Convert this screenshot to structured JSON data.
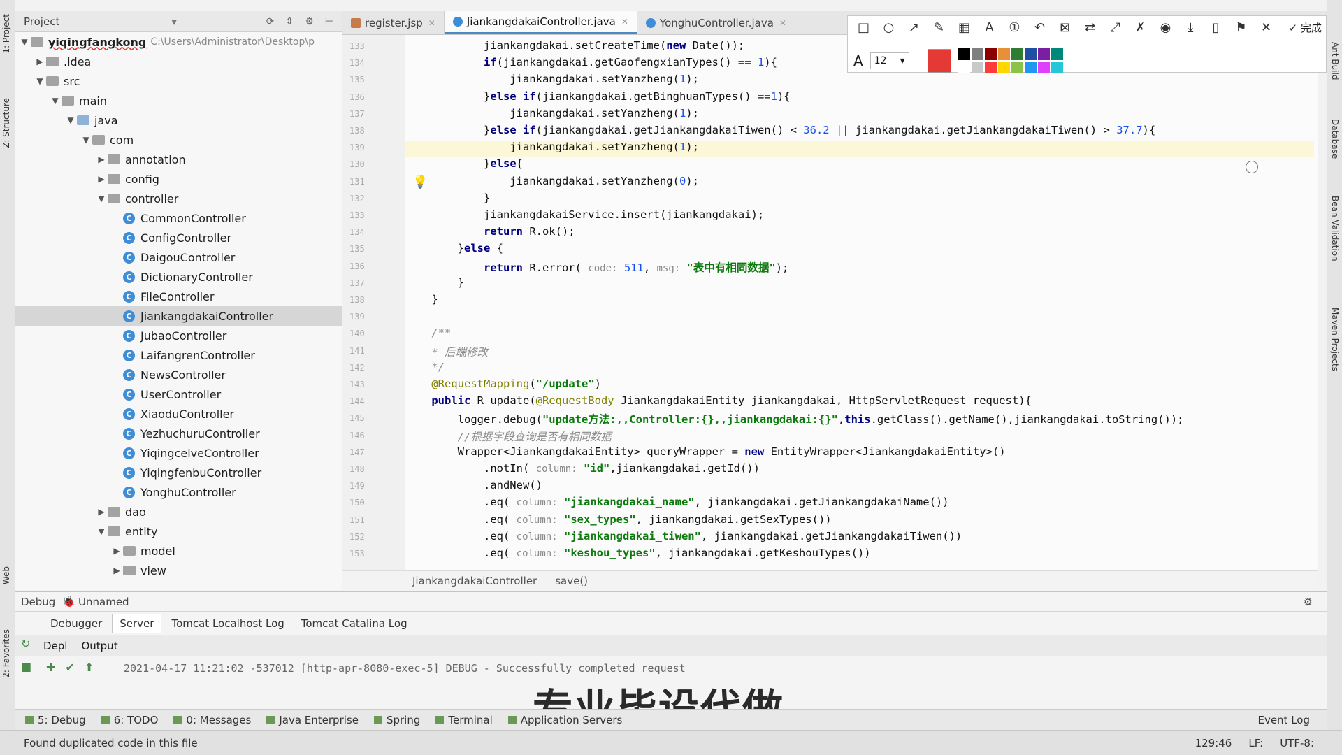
{
  "left_strip": {
    "tab1": "1: Project",
    "tab2": "Z: Structure",
    "tab3": "Web",
    "tab4": "2: Favorites"
  },
  "right_strip": {
    "tab1": "Ant Build",
    "tab2": "Database",
    "tab3": "Bean Validation",
    "tab4": "Maven Projects"
  },
  "project": {
    "header": "Project",
    "root": "yiqingfangkong",
    "root_path": "C:\\Users\\Administrator\\Desktop\\p",
    "tree": [
      {
        "label": ".idea",
        "level": 1,
        "arrow": "▶",
        "kind": "folder"
      },
      {
        "label": "src",
        "level": 1,
        "arrow": "▼",
        "kind": "folder"
      },
      {
        "label": "main",
        "level": 2,
        "arrow": "▼",
        "kind": "folder"
      },
      {
        "label": "java",
        "level": 3,
        "arrow": "▼",
        "kind": "folder-blue"
      },
      {
        "label": "com",
        "level": 4,
        "arrow": "▼",
        "kind": "folder"
      },
      {
        "label": "annotation",
        "level": 5,
        "arrow": "▶",
        "kind": "folder"
      },
      {
        "label": "config",
        "level": 5,
        "arrow": "▶",
        "kind": "folder"
      },
      {
        "label": "controller",
        "level": 5,
        "arrow": "▼",
        "kind": "folder"
      },
      {
        "label": "CommonController",
        "level": 6,
        "kind": "class"
      },
      {
        "label": "ConfigController",
        "level": 6,
        "kind": "class"
      },
      {
        "label": "DaigouController",
        "level": 6,
        "kind": "class"
      },
      {
        "label": "DictionaryController",
        "level": 6,
        "kind": "class"
      },
      {
        "label": "FileController",
        "level": 6,
        "kind": "class"
      },
      {
        "label": "JiankangdakaiController",
        "level": 6,
        "kind": "class",
        "selected": true
      },
      {
        "label": "JubaoController",
        "level": 6,
        "kind": "class"
      },
      {
        "label": "LaifangrenController",
        "level": 6,
        "kind": "class"
      },
      {
        "label": "NewsController",
        "level": 6,
        "kind": "class"
      },
      {
        "label": "UserController",
        "level": 6,
        "kind": "class"
      },
      {
        "label": "XiaoduController",
        "level": 6,
        "kind": "class"
      },
      {
        "label": "YezhuchuruController",
        "level": 6,
        "kind": "class"
      },
      {
        "label": "YiqingcelveController",
        "level": 6,
        "kind": "class"
      },
      {
        "label": "YiqingfenbuController",
        "level": 6,
        "kind": "class"
      },
      {
        "label": "YonghuController",
        "level": 6,
        "kind": "class"
      },
      {
        "label": "dao",
        "level": 5,
        "arrow": "▶",
        "kind": "folder"
      },
      {
        "label": "entity",
        "level": 5,
        "arrow": "▼",
        "kind": "folder"
      },
      {
        "label": "model",
        "level": 6,
        "arrow": "▶",
        "kind": "folder"
      },
      {
        "label": "view",
        "level": 6,
        "arrow": "▶",
        "kind": "folder"
      }
    ]
  },
  "tabs": [
    {
      "label": "register.jsp",
      "type": "jsp"
    },
    {
      "label": "JiankangdakaiController.java",
      "type": "java",
      "active": true
    },
    {
      "label": "YonghuController.java",
      "type": "java"
    }
  ],
  "toolbar": {
    "finish_label": "完成",
    "font_size": "12",
    "icons": [
      "rect-icon",
      "ellipse-icon",
      "arrow-icon",
      "pen-icon",
      "mosaic-icon",
      "text-icon",
      "number-icon",
      "undo-icon",
      "close-shape-icon",
      "translate-icon",
      "scroll-icon",
      "pin-icon",
      "record-icon",
      "download-icon",
      "save-icon",
      "bookmark-icon",
      "cancel-icon"
    ],
    "palette": [
      "#000000",
      "#7f7f7f",
      "#8b0000",
      "#e69138",
      "#2e7d32",
      "#1e4fa3",
      "#7b1fa2",
      "#00897b",
      "#ffffff",
      "#c9c9c9",
      "#ff3b3b",
      "#ffd600",
      "#8bc34a",
      "#2196f3",
      "#e040fb",
      "#26c6da"
    ],
    "current_color": "#e53935"
  },
  "editor": {
    "line_numbers": [
      "133",
      "134",
      "135",
      "136",
      "137",
      "138",
      "139",
      "130",
      "131",
      "132",
      "133",
      "134",
      "135",
      "136",
      "137",
      "138",
      "139",
      "140",
      "141",
      "142",
      "143",
      "144",
      "145",
      "146",
      "147",
      "148",
      "149",
      "150",
      "151",
      "152",
      "153"
    ],
    "lines": [
      "            jiankangdakai.setCreateTime(new Date());",
      "            if(jiankangdakai.getGaofengxianTypes() == 1){",
      "                jiankangdakai.setYanzheng(1);",
      "            }else if(jiankangdakai.getBinghuanTypes() ==1){",
      "                jiankangdakai.setYanzheng(1);",
      "            }else if(jiankangdakai.getJiankangdakaiTiwen() < 36.2 || jiankangdakai.getJiankangdakaiTiwen() > 37.7){",
      "                jiankangdakai.setYanzheng(1);",
      "            }else{",
      "                jiankangdakai.setYanzheng(0);",
      "            }",
      "            jiankangdakaiService.insert(jiankangdakai);",
      "            return R.ok();",
      "        }else {",
      "            return R.error( code: 511, msg: \"表中有相同数据\");",
      "        }",
      "    }",
      "",
      "    /**",
      "    * 后端修改",
      "    */",
      "    @RequestMapping(\"/update\")",
      "    public R update(@RequestBody JiankangdakaiEntity jiankangdakai, HttpServletRequest request){",
      "        logger.debug(\"update方法:,,Controller:{},,jiankangdakai:{}\",this.getClass().getName(),jiankangdakai.toString());",
      "        //根据字段查询是否有相同数据",
      "        Wrapper<JiankangdakaiEntity> queryWrapper = new EntityWrapper<JiankangdakaiEntity>()",
      "            .notIn( column: \"id\",jiankangdakai.getId())",
      "            .andNew()",
      "            .eq( column: \"jiankangdakai_name\", jiankangdakai.getJiankangdakaiName())",
      "            .eq( column: \"sex_types\", jiankangdakai.getSexTypes())",
      "            .eq( column: \"jiankangdakai_tiwen\", jiankangdakai.getJiankangdakaiTiwen())",
      "            .eq( column: \"keshou_types\", jiankangdakai.getKeshouTypes())"
    ]
  },
  "breadcrumb": {
    "cls": "JiankangdakaiController",
    "method": "save()"
  },
  "debug": {
    "title": "Debug",
    "config": "Unnamed",
    "tabs": [
      "Debugger",
      "Server",
      "Tomcat Localhost Log",
      "Tomcat Catalina Log"
    ],
    "sub_tabs": [
      "Depl",
      "Output"
    ],
    "log": "2021-04-17 11:21:02 -537012 [http-apr-8080-exec-5] DEBUG  - Successfully completed request",
    "watermark": "专业毕设代做"
  },
  "tool_windows": [
    "5: Debug",
    "6: TODO",
    "0: Messages",
    "Java Enterprise",
    "Spring",
    "Terminal",
    "Application Servers"
  ],
  "event_log": "Event Log",
  "status": {
    "message": "Found duplicated code in this file",
    "position": "129:46",
    "line_sep": "LF:",
    "encoding": "UTF-8:"
  }
}
